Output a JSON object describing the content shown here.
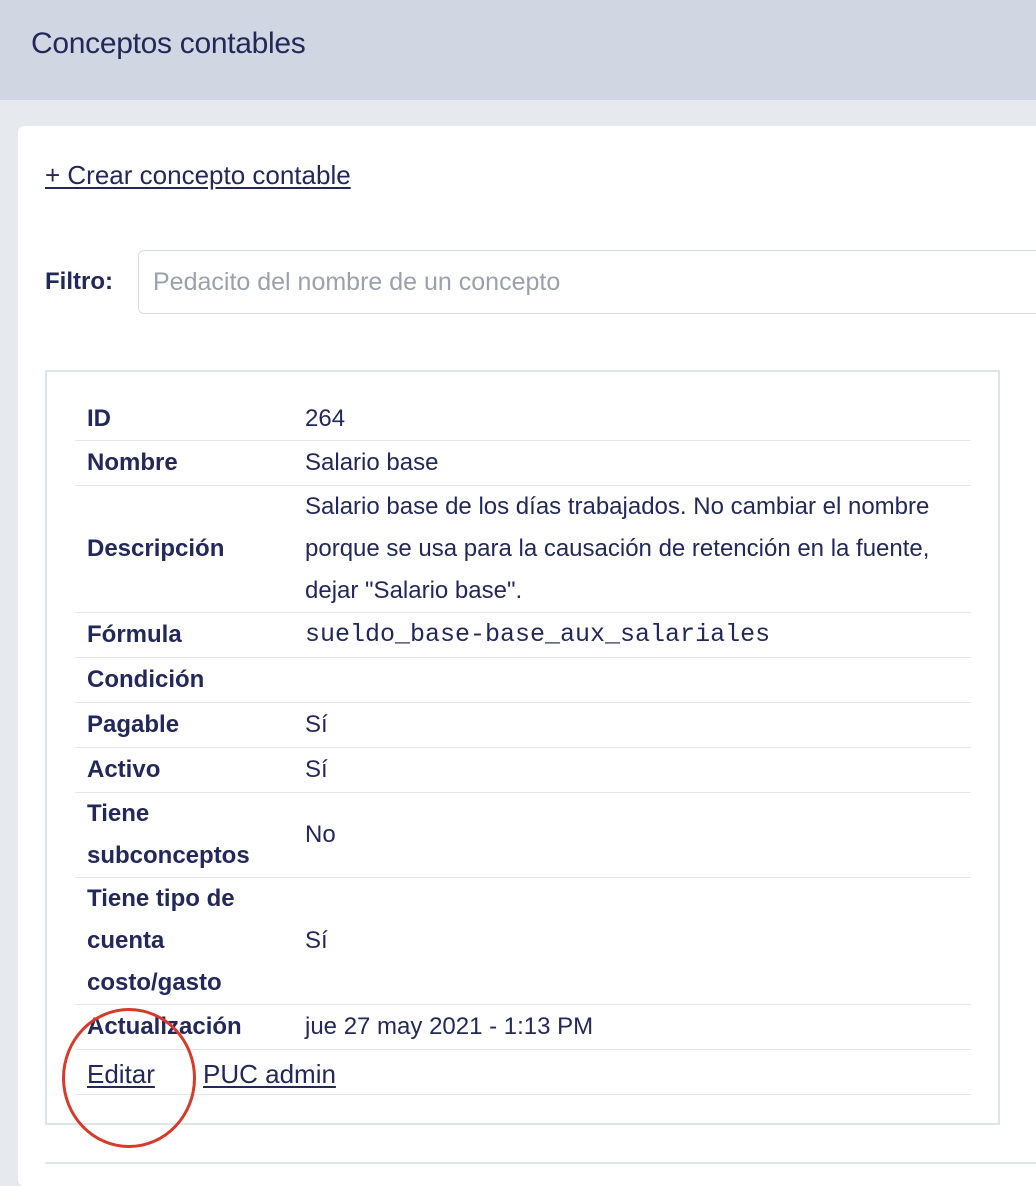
{
  "header": {
    "title": "Conceptos contables"
  },
  "actions": {
    "create_label": "+ Crear concepto contable"
  },
  "filter": {
    "label": "Filtro:",
    "placeholder": "Pedacito del nombre de un concepto",
    "value": ""
  },
  "concept": {
    "rows": [
      {
        "key": "ID",
        "value": "264"
      },
      {
        "key": "Nombre",
        "value": "Salario base"
      },
      {
        "key": "Descripción",
        "value": "Salario base de los días trabajados. No cambiar el nombre porque se usa para la causación de retención en la fuente, dejar \"Salario base\"."
      },
      {
        "key": "Fórmula",
        "value": "sueldo_base-base_aux_salariales"
      },
      {
        "key": "Condición",
        "value": ""
      },
      {
        "key": "Pagable",
        "value": "Sí"
      },
      {
        "key": "Activo",
        "value": "Sí"
      },
      {
        "key": "Tiene subconceptos",
        "value": "No"
      },
      {
        "key": "Tiene tipo de cuenta costo/gasto",
        "value": "Sí"
      },
      {
        "key": "Actualización",
        "value": "jue 27 may 2021 - 1:13 PM"
      }
    ],
    "links": {
      "edit_label": "Editar",
      "puc_label": "PUC admin"
    }
  },
  "annotation": {
    "highlight_color": "#d63a2b"
  }
}
